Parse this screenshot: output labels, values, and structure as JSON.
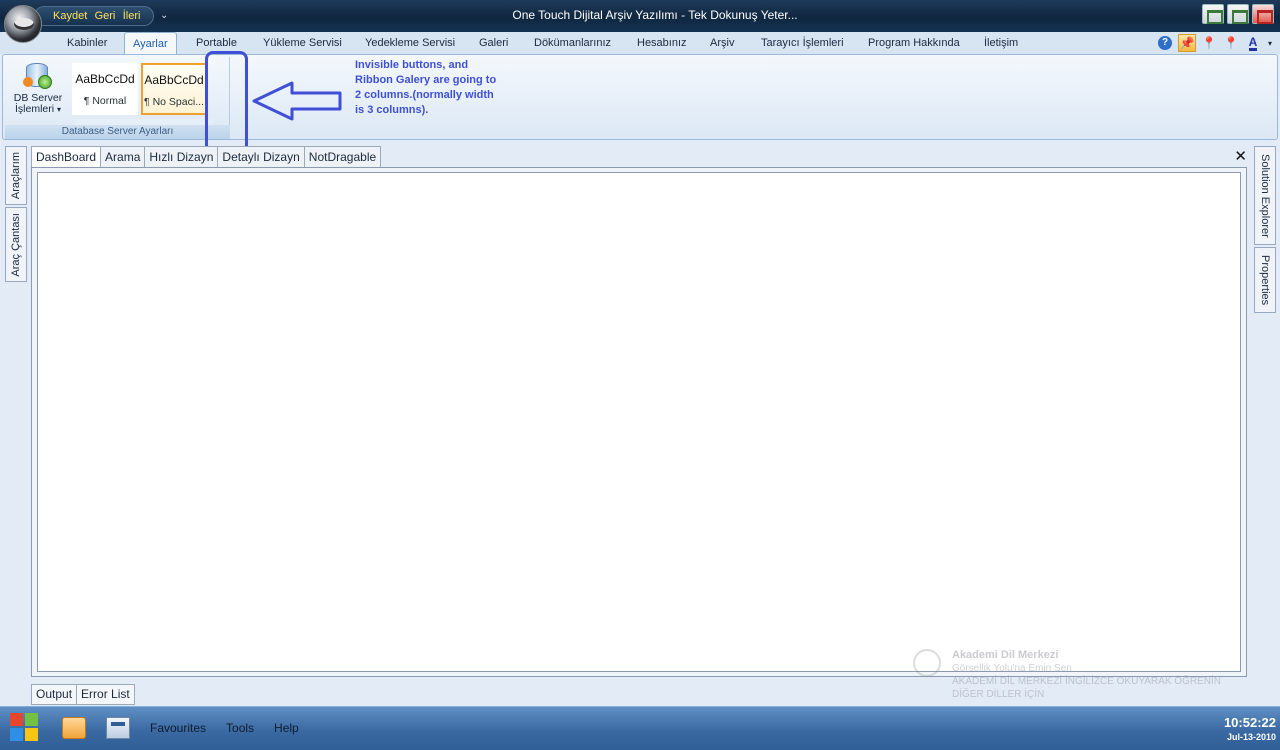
{
  "titlebar": {
    "title": "One Touch Dijital Arşiv Yazılımı - Tek Dokunuş Yeter...",
    "quick_access": [
      "Kaydet",
      "Geri",
      "İleri"
    ]
  },
  "ribbon_tabs": [
    {
      "label": "Kabinler"
    },
    {
      "label": "Ayarlar"
    },
    {
      "label": "Portable"
    },
    {
      "label": "Yükleme Servisi"
    },
    {
      "label": "Yedekleme Servisi"
    },
    {
      "label": "Galeri"
    },
    {
      "label": "Dökümanlarınız"
    },
    {
      "label": "Hesabınız"
    },
    {
      "label": "Arşiv"
    },
    {
      "label": "Tarayıcı İşlemleri"
    },
    {
      "label": "Program Hakkında"
    },
    {
      "label": "İletişim"
    }
  ],
  "active_tab": "Ayarlar",
  "ribbon": {
    "db_button": {
      "line1": "DB Server",
      "line2": "İşlemleri"
    },
    "gallery": [
      {
        "sample": "AaBbCcDd",
        "name": "¶ Normal"
      },
      {
        "sample": "AaBbCcDd",
        "name": "¶ No Spaci..."
      }
    ],
    "group_label": "Database Server Ayarları"
  },
  "annotation": "Invisible buttons, and Ribbon Galery are going to 2 columns.(normally width is 3 columns).",
  "left_dock": [
    "Araçlarım",
    "Araç Çantası"
  ],
  "right_dock": [
    "Solution Explorer",
    "Properties"
  ],
  "document_tabs": [
    "DashBoard",
    "Arama",
    "Hızlı Dizayn",
    "Detaylı Dizayn",
    "NotDragable"
  ],
  "active_document": "DashBoard",
  "bottom_tabs": [
    "Output",
    "Error List"
  ],
  "toast": {
    "title": "Akademi Dil Merkezi",
    "line1": "Görsellik Yolu'na Emin Sen",
    "line2": "AKADEMİ DİL MERKEZİ İNGİLİZCE OKUYARAK ÖĞRENİN",
    "line3": "DİĞER DİLLER İÇİN"
  },
  "taskbar": {
    "menu": [
      "Favourites",
      "Tools",
      "Help"
    ],
    "time": "10:52:22",
    "date": "Jul-13-2010"
  },
  "colors": {
    "accent": "#3f4fd6",
    "titlebar": "#0f2740",
    "taskbar": "#3b6aa3"
  }
}
